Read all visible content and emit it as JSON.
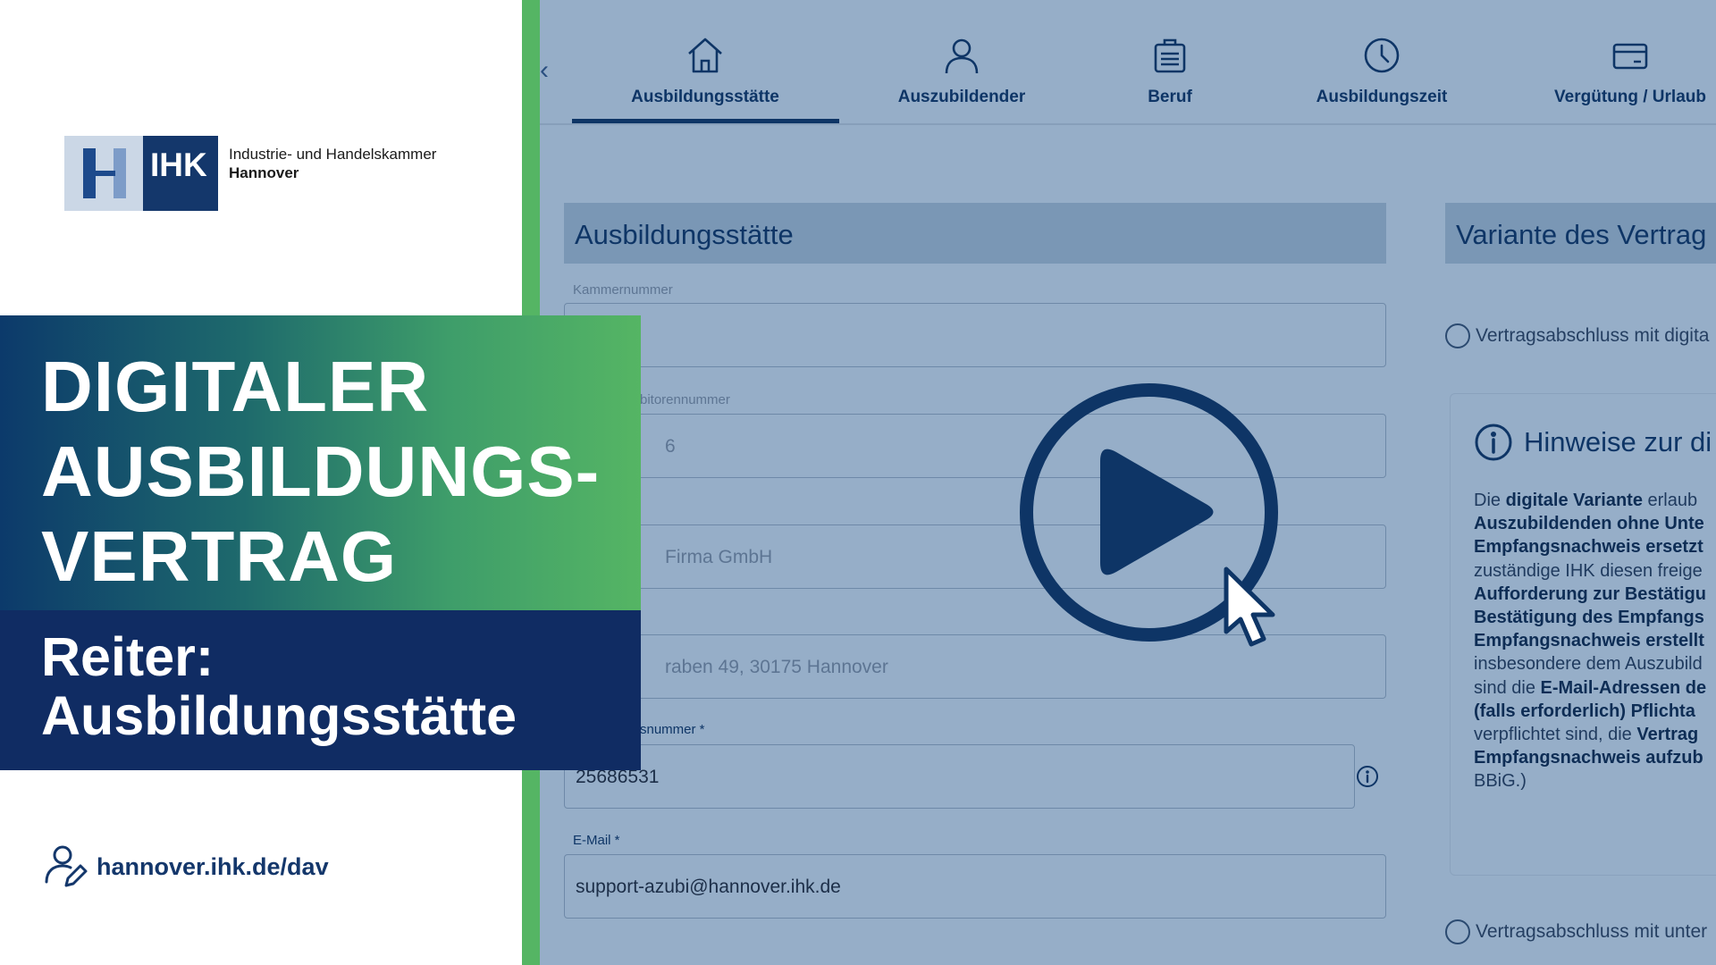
{
  "logo": {
    "abbr": "IHK",
    "name_line1": "Industrie- und Handelskammer",
    "name_line2": "Hannover"
  },
  "title": {
    "line1": "DIGITALER",
    "line2": "AUSBILDUNGS-",
    "line3": "VERTRAG"
  },
  "subtitle": {
    "line1": "Reiter:",
    "line2": "Ausbildungsstätte"
  },
  "footer": {
    "link": "hannover.ihk.de/dav",
    "icon": "user-edit-icon"
  },
  "tabs": [
    {
      "label": "Ausbildungsstätte",
      "icon": "home-icon",
      "active": true
    },
    {
      "label": "Auszubildender",
      "icon": "person-icon"
    },
    {
      "label": "Beruf",
      "icon": "briefcase-icon"
    },
    {
      "label": "Ausbildungszeit",
      "icon": "clock-icon"
    },
    {
      "label": "Vergütung / Urlaub",
      "icon": "card-icon"
    }
  ],
  "form": {
    "section_title": "Ausbildungsstätte",
    "fields": [
      {
        "label": "Kammernummer",
        "value": ""
      },
      {
        "label": "bitorennummer",
        "value": "6"
      },
      {
        "label": "",
        "value": "Firma GmbH"
      },
      {
        "label": "",
        "value": "raben 49, 30175 Hannover"
      },
      {
        "label": "snummer *",
        "value": "25686531"
      },
      {
        "label": "E-Mail *",
        "value": "support-azubi@hannover.ihk.de"
      }
    ]
  },
  "variant": {
    "section_title": "Variante des Vertrag",
    "option1": "Vertragsabschluss mit digita",
    "option2": "Vertragsabschluss mit unter",
    "hint_title": "Hinweise zur di",
    "hint_lines": [
      {
        "pre": "Die ",
        "bold": "digitale Variante",
        "post": " erlaub"
      },
      {
        "pre": "",
        "bold": "Auszubildenden ohne Unte",
        "post": ""
      },
      {
        "pre": "",
        "bold": "Empfangsnachweis ersetzt",
        "post": ""
      },
      {
        "pre": "zuständige IHK diesen freige",
        "bold": "",
        "post": ""
      },
      {
        "pre": "",
        "bold": "Aufforderung zur Bestätigu",
        "post": ""
      },
      {
        "pre": "",
        "bold": "Bestätigung des Empfangs",
        "post": ""
      },
      {
        "pre": "",
        "bold": "Empfangsnachweis erstellt",
        "post": ""
      },
      {
        "pre": "insbesondere dem Auszubild",
        "bold": "",
        "post": ""
      },
      {
        "pre": "sind die ",
        "bold": "E-Mail-Adressen de",
        "post": ""
      },
      {
        "pre": "",
        "bold": "(falls erforderlich) Pflichta",
        "post": ""
      },
      {
        "pre": "verpflichtet sind, die ",
        "bold": "Vertrag",
        "post": ""
      },
      {
        "pre": "",
        "bold": "Empfangsnachweis aufzub",
        "post": ""
      },
      {
        "pre": "BBiG.)",
        "bold": "",
        "post": ""
      }
    ]
  },
  "colors": {
    "navy": "#14376b",
    "green": "#55b564",
    "overlay": "#96aec8"
  }
}
